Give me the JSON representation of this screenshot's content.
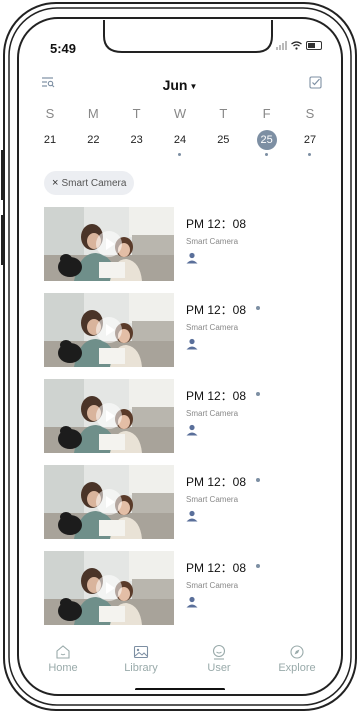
{
  "status": {
    "time": "5:49"
  },
  "header": {
    "month": "Jun"
  },
  "calendar": {
    "days": [
      {
        "dow": "S",
        "date": "21",
        "has_events": false,
        "selected": false
      },
      {
        "dow": "M",
        "date": "22",
        "has_events": false,
        "selected": false
      },
      {
        "dow": "T",
        "date": "23",
        "has_events": false,
        "selected": false
      },
      {
        "dow": "W",
        "date": "24",
        "has_events": true,
        "selected": false
      },
      {
        "dow": "T",
        "date": "25",
        "has_events": false,
        "selected": false
      },
      {
        "dow": "F",
        "date": "25",
        "has_events": true,
        "selected": true
      },
      {
        "dow": "S",
        "date": "27",
        "has_events": true,
        "selected": false
      }
    ]
  },
  "filter_chip": {
    "close": "×",
    "label": "Smart Camera"
  },
  "events": [
    {
      "time": "PM 12：08",
      "camera": "Smart Camera",
      "unread": false
    },
    {
      "time": "PM 12：08",
      "camera": "Smart Camera",
      "unread": true
    },
    {
      "time": "PM 12：08",
      "camera": "Smart Camera",
      "unread": true
    },
    {
      "time": "PM 12：08",
      "camera": "Smart Camera",
      "unread": true
    },
    {
      "time": "PM 12：08",
      "camera": "Smart Camera",
      "unread": true
    }
  ],
  "tabs": [
    {
      "label": "Home",
      "icon": "home-icon"
    },
    {
      "label": "Library",
      "icon": "library-icon"
    },
    {
      "label": "User",
      "icon": "user-icon"
    },
    {
      "label": "Explore",
      "icon": "compass-icon"
    }
  ],
  "colors": {
    "accent": "#7d8fa3",
    "person_icon": "#5a6f9a"
  }
}
